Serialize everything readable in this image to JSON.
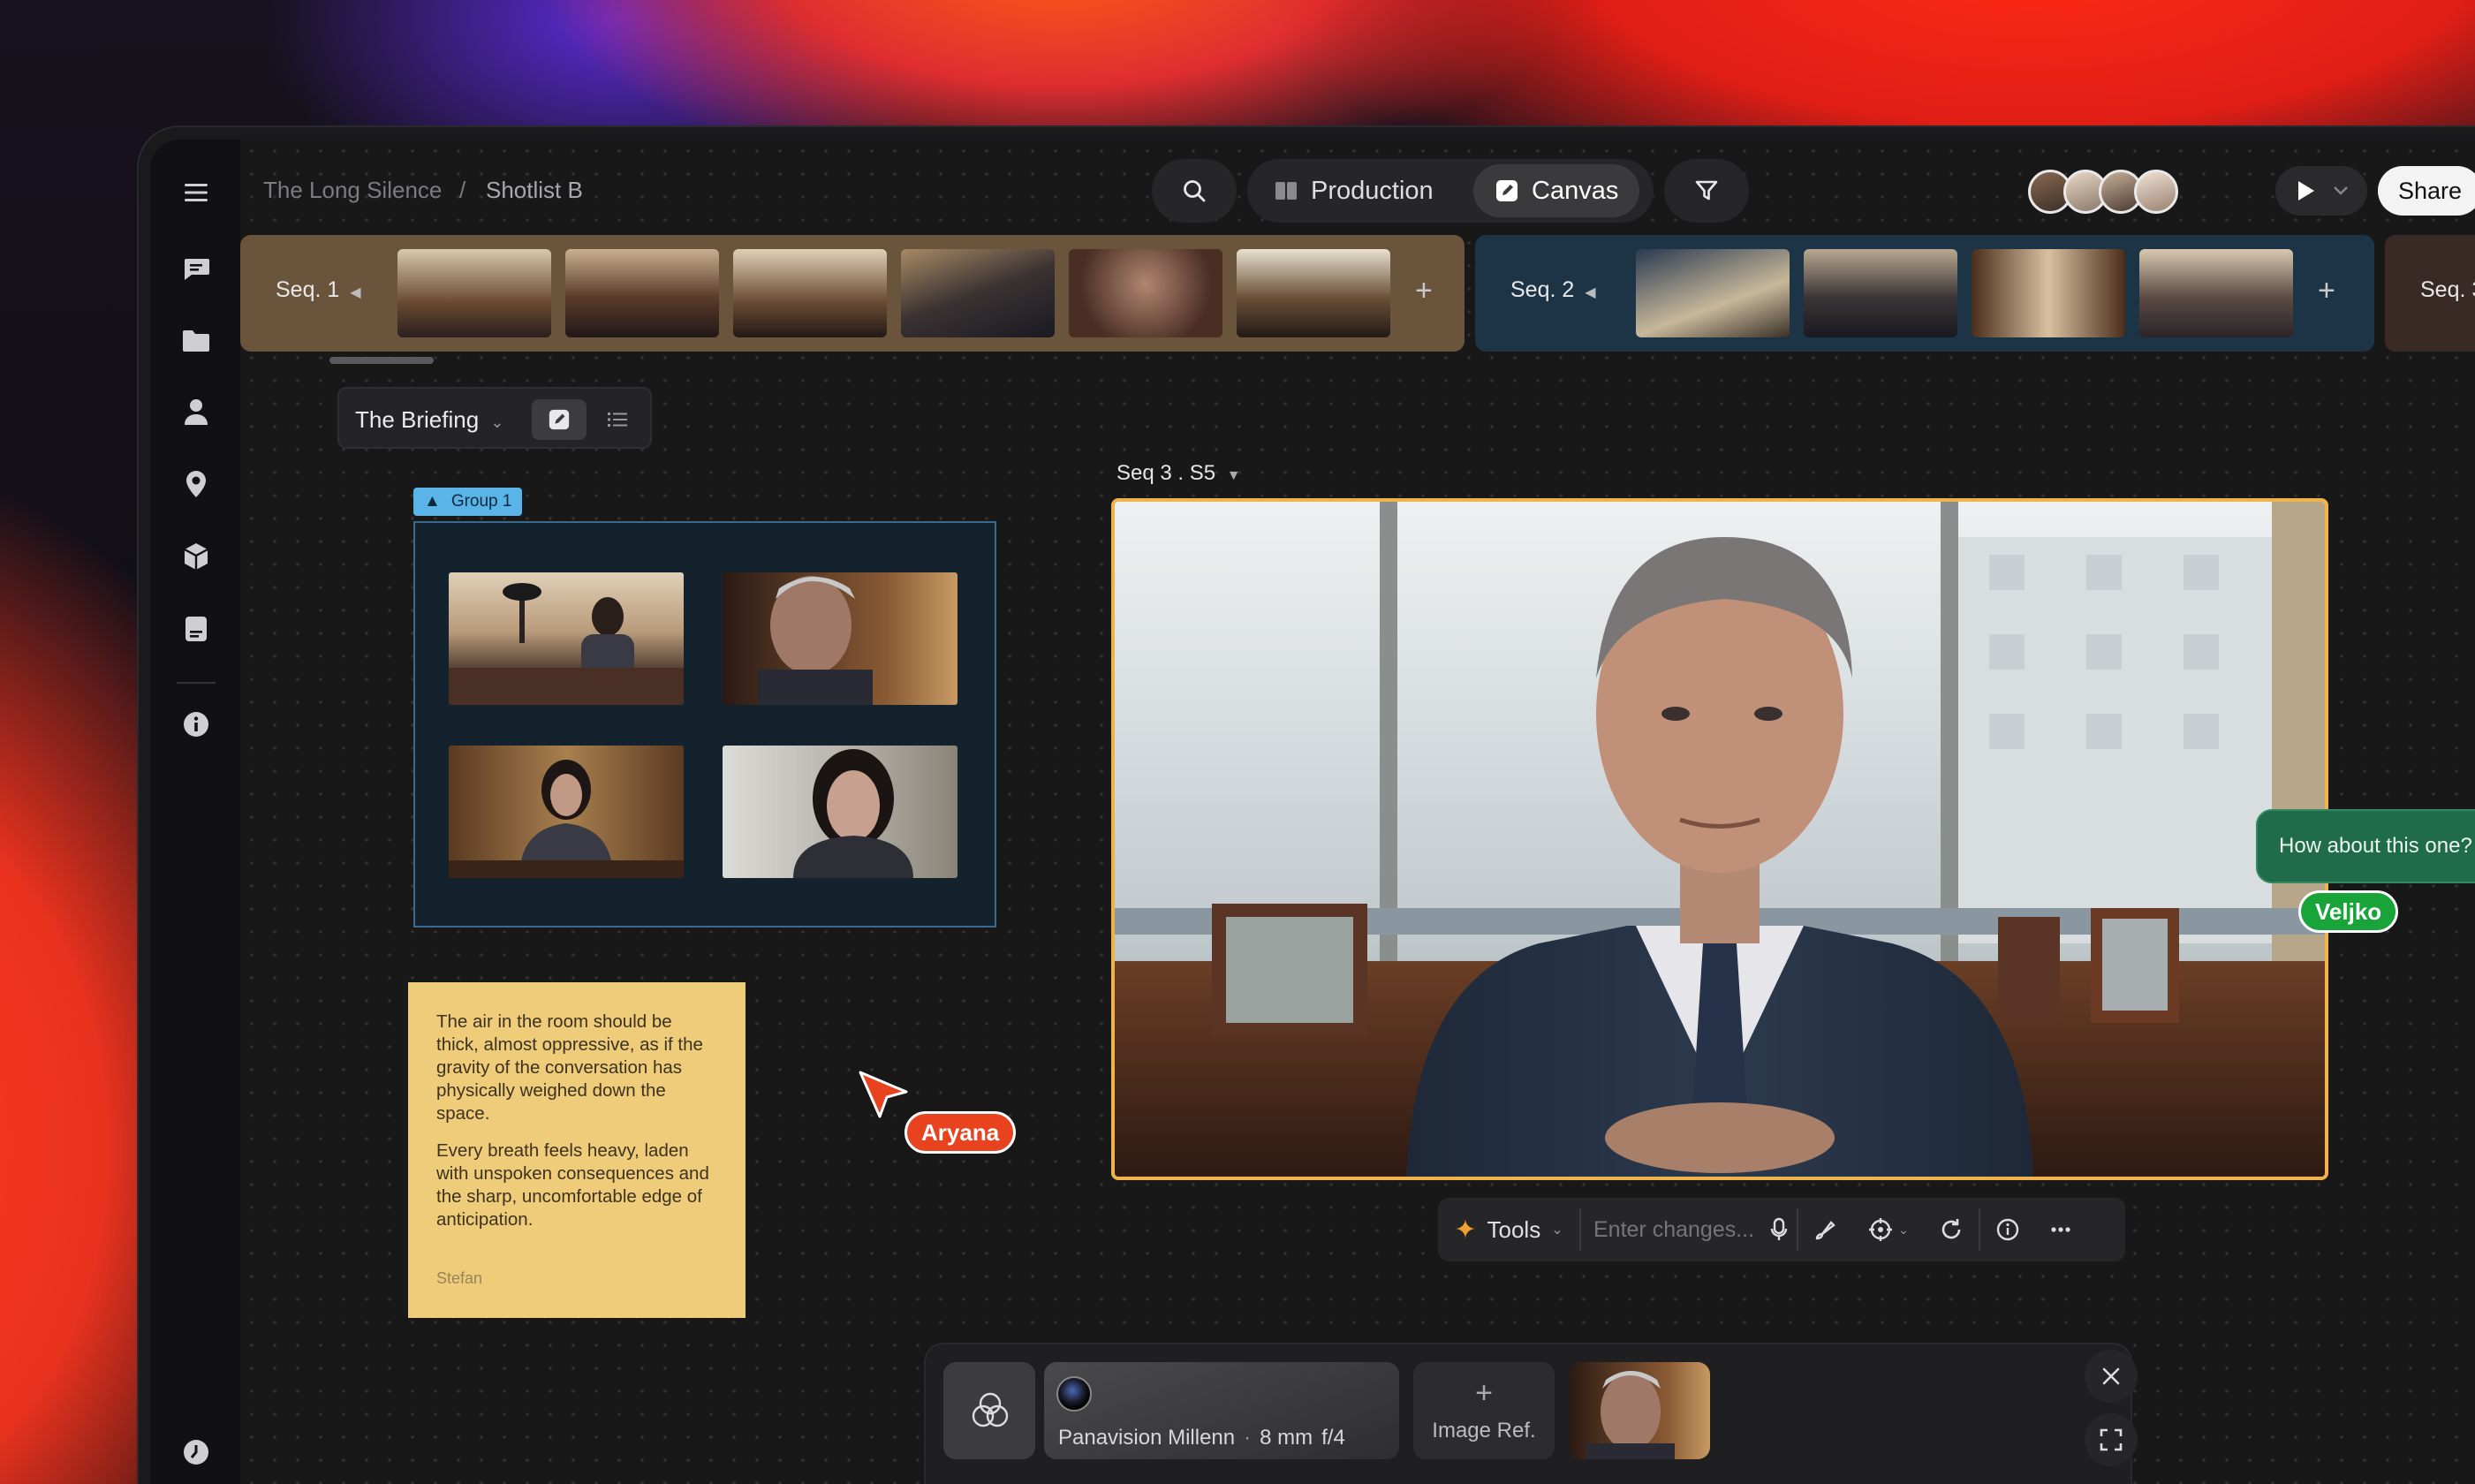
{
  "breadcrumb": {
    "project": "The Long Silence",
    "separator": "/",
    "page": "Shotlist B"
  },
  "modes": {
    "production": "Production",
    "canvas": "Canvas"
  },
  "share_label": "Share",
  "sequences": [
    {
      "label": "Seq. 1",
      "bg": "#6b543c"
    },
    {
      "label": "Seq. 2",
      "bg": "#1d3447"
    },
    {
      "label": "Seq. 3",
      "bg": "#3a2a26"
    }
  ],
  "scene": {
    "name": "The Briefing"
  },
  "group": {
    "label": "Group 1"
  },
  "sticky_note": {
    "paragraph1": "The air in the room should be thick, almost oppressive, as if the gravity of the conversation has physically weighed down the space.",
    "paragraph2": "Every breath feels heavy, laden with unspoken consequences and the sharp, uncomfortable edge of anticipation.",
    "author": "Stefan"
  },
  "cursors": {
    "aryana": {
      "name": "Aryana",
      "color": "#e8431e"
    },
    "veljko": {
      "name": "Veljko",
      "color": "#19a43a"
    }
  },
  "shot": {
    "label": "Seq 3 . S5"
  },
  "comment": {
    "text": "How about this one?"
  },
  "toolbar": {
    "tools_label": "Tools",
    "input_placeholder": "Enter changes..."
  },
  "generator": {
    "camera_name": "Panavision Millenn",
    "lens": "8 mm",
    "aperture": "f/4",
    "image_ref_label": "Image Ref."
  },
  "colors": {
    "accent_orange": "#f0b24a",
    "group_blue": "#5ab4e8",
    "sticky": "#efcc7a"
  }
}
